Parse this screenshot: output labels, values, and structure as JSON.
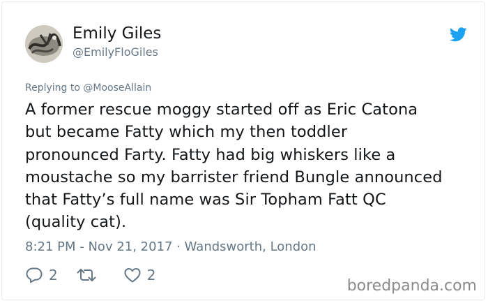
{
  "colors": {
    "text": "#14171a",
    "secondary": "#657786",
    "twitter_blue": "#1da1f2",
    "watermark": "#8a8a8a"
  },
  "author": {
    "name": "Emily Giles",
    "handle": "@EmilyFloGiles",
    "avatar_icon": "avatar-photo"
  },
  "logo_icon": "twitter-bird-icon",
  "reply": {
    "prefix": "Replying to",
    "mention": "@MooseAllain"
  },
  "tweet": {
    "lines": [
      "A former rescue moggy started off as Eric Catona",
      "but became Fatty which my then toddler",
      "pronounced Farty. Fatty had big whiskers like a",
      "moustache so my barrister friend Bungle announced",
      "that Fatty’s full name was Sir Topham Fatt QC",
      "(quality cat)."
    ]
  },
  "meta": {
    "text": "8:21 PM - Nov 21, 2017 · Wandsworth, London"
  },
  "actions": {
    "reply_count": "2",
    "retweet_count": "",
    "like_count": "2"
  },
  "watermark": "boredpanda.com"
}
